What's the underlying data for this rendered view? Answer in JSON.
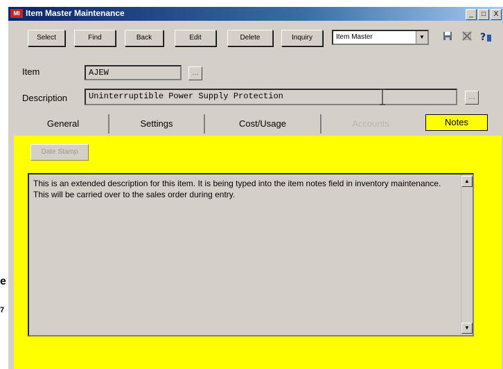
{
  "window": {
    "title": "Item Master Maintenance",
    "app_badge": "MI",
    "title_buttons": [
      "_",
      "□",
      "X"
    ]
  },
  "background_fragments": [
    "e",
    "7"
  ],
  "toolbar": {
    "buttons": [
      "Select",
      "Find",
      "Back",
      "Edit",
      "Delete",
      "Inquiry"
    ],
    "combo_value": "Item Master",
    "combo_arrow": "▼",
    "icons": [
      "save-icon",
      "exit-icon",
      "help-icon"
    ]
  },
  "item": {
    "label": "Item",
    "value": "AJEW",
    "lookup_glyph": "…"
  },
  "description": {
    "label": "Description",
    "value": "Uninterruptible Power Supply Protection",
    "lookup_glyph": "…"
  },
  "tabs": [
    {
      "label": "General",
      "state": "normal"
    },
    {
      "label": "Settings",
      "state": "normal"
    },
    {
      "label": "Cost/Usage",
      "state": "normal"
    },
    {
      "label": "Accounts",
      "state": "disabled"
    },
    {
      "label": "Notes",
      "state": "active"
    }
  ],
  "notes_panel": {
    "date_stamp_label": "Date Stamp",
    "text": "This is an extended description for this item.  It is being typed into the item notes field in inventory maintenance.  This will be carried over to the sales order during entry.",
    "scroll_up": "▲",
    "scroll_down": "▼"
  },
  "colors": {
    "panel_bg": "#ffff00",
    "title_bar": "#0a246a",
    "window_bg": "#d4d0c8"
  }
}
